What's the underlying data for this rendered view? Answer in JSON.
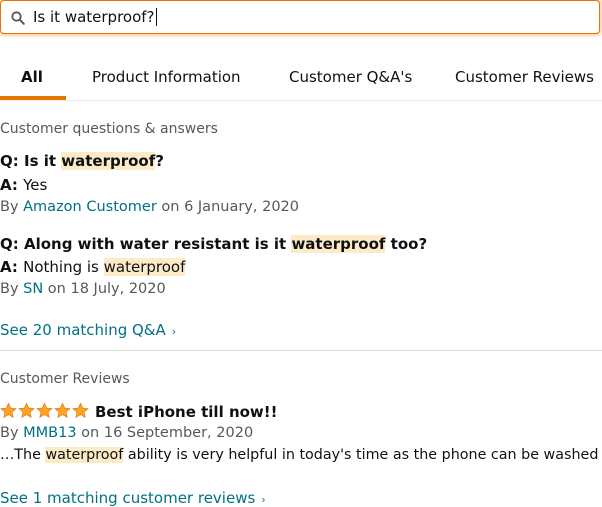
{
  "search": {
    "query": "Is it waterproof?"
  },
  "tabs": [
    {
      "label": "All"
    },
    {
      "label": "Product Information"
    },
    {
      "label": "Customer Q&A's"
    },
    {
      "label": "Customer Reviews"
    }
  ],
  "qa": {
    "section_title": "Customer questions & answers",
    "items": [
      {
        "q_prefix": "Q: ",
        "q_before": "Is it ",
        "q_highlight": "waterproof",
        "q_after": "?",
        "a_prefix": "A: ",
        "a_before": "Yes",
        "a_highlight": "",
        "a_after": "",
        "by": "By ",
        "author": "Amazon Customer",
        "date": " on 6 January, 2020"
      },
      {
        "q_prefix": "Q: ",
        "q_before": "Along with water resistant is it ",
        "q_highlight": "waterproof",
        "q_after": " too?",
        "a_prefix": "A: ",
        "a_before": "Nothing is ",
        "a_highlight": "waterproof",
        "a_after": "",
        "by": "By ",
        "author": "SN",
        "date": " on 18 July, 2020"
      }
    ],
    "see_all": "See 20 matching Q&A"
  },
  "reviews": {
    "section_title": "Customer Reviews",
    "items": [
      {
        "rating": 5,
        "title": "Best iPhone till now!!",
        "by": "By ",
        "author": "MMB13",
        "date": " on 16 September, 2020",
        "snippet_before": "…The ",
        "snippet_highlight": "waterproof",
        "snippet_after": " ability is very helpful in today's time as the phone can be washed"
      }
    ],
    "see_all": "See 1 matching customer reviews"
  },
  "colors": {
    "accent": "#e77600",
    "link": "#007185",
    "highlight": "#fdebc8",
    "star": "#ffa41c"
  }
}
